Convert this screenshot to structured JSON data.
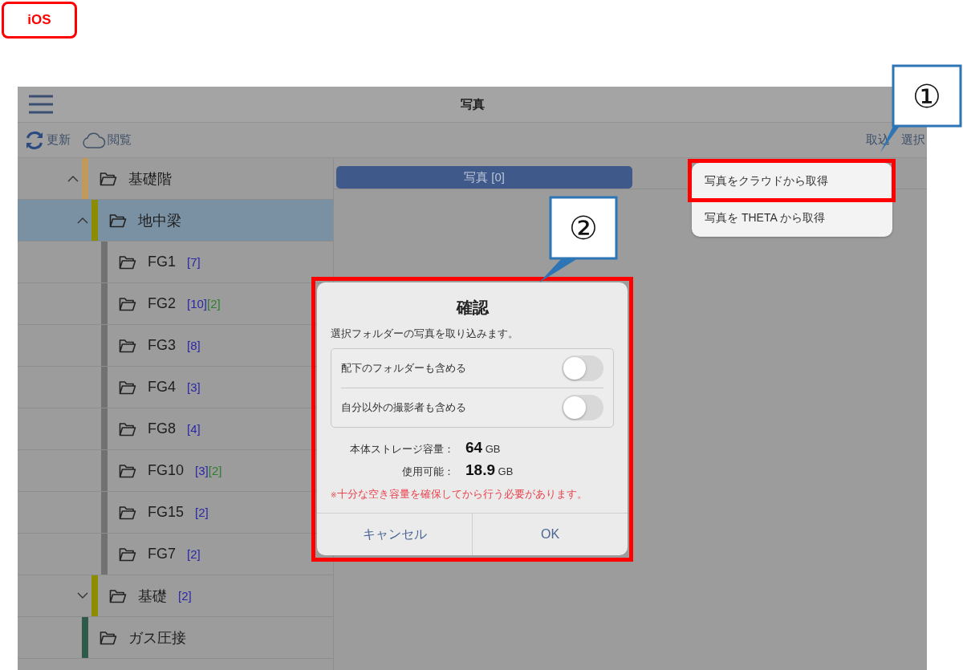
{
  "platform_badge": "iOS",
  "header": {
    "title": "写真"
  },
  "toolbar": {
    "left": [
      {
        "label": "更新",
        "kind": "refresh"
      },
      {
        "label": "閲覧",
        "kind": "cloud"
      }
    ],
    "right": [
      {
        "label": "取込"
      },
      {
        "label": "選択"
      }
    ]
  },
  "tree": [
    {
      "label": "基礎階",
      "color": "#c09a5b",
      "expanded": true,
      "selected": false,
      "children": [
        {
          "label": "地中梁",
          "color": "#8c8c00",
          "expanded": true,
          "selected": true,
          "children": [
            {
              "label": "FG1",
              "color": "#727272",
              "selected": false,
              "counts": [
                {
                  "text": "[7]",
                  "kind": "photos"
                }
              ]
            },
            {
              "label": "FG2",
              "color": "#727272",
              "selected": false,
              "counts": [
                {
                  "text": "[10]",
                  "kind": "photos"
                },
                {
                  "text": "[2]",
                  "kind": "other"
                }
              ]
            },
            {
              "label": "FG3",
              "color": "#727272",
              "selected": false,
              "counts": [
                {
                  "text": "[8]",
                  "kind": "photos"
                }
              ]
            },
            {
              "label": "FG4",
              "color": "#727272",
              "selected": false,
              "counts": [
                {
                  "text": "[3]",
                  "kind": "photos"
                }
              ]
            },
            {
              "label": "FG8",
              "color": "#727272",
              "selected": false,
              "counts": [
                {
                  "text": "[4]",
                  "kind": "photos"
                }
              ]
            },
            {
              "label": "FG10",
              "color": "#727272",
              "selected": false,
              "counts": [
                {
                  "text": "[3]",
                  "kind": "photos"
                },
                {
                  "text": "[2]",
                  "kind": "other"
                }
              ]
            },
            {
              "label": "FG15",
              "color": "#727272",
              "selected": false,
              "counts": [
                {
                  "text": "[2]",
                  "kind": "photos"
                }
              ]
            },
            {
              "label": "FG7",
              "color": "#727272",
              "selected": false,
              "counts": [
                {
                  "text": "[2]",
                  "kind": "photos"
                }
              ]
            }
          ]
        },
        {
          "label": "基礎",
          "color": "#8c8c00",
          "expanded": false,
          "selected": false,
          "counts": [
            {
              "text": "[2]",
              "kind": "photos"
            }
          ]
        }
      ]
    },
    {
      "label": "ガス圧接",
      "color": "#2f5a4a",
      "selected": false
    }
  ],
  "photo_tab": {
    "label": "写真 [0]"
  },
  "import_menu": {
    "items": [
      "写真をクラウドから取得",
      "写真を THETA から取得"
    ]
  },
  "dialog": {
    "title": "確認",
    "message": "選択フォルダーの写真を取り込みます。",
    "toggles": [
      {
        "label": "配下のフォルダーも含める",
        "on": false
      },
      {
        "label": "自分以外の撮影者も含める",
        "on": false
      }
    ],
    "storage": [
      {
        "label": "本体ストレージ容量：",
        "value": "64",
        "unit": "GB"
      },
      {
        "label": "使用可能：",
        "value": "18.9",
        "unit": "GB"
      }
    ],
    "warning_mark": "※",
    "warning": "十分な空き容量を確保してから行う必要があります。",
    "buttons": [
      "キャンセル",
      "OK"
    ]
  },
  "callouts": [
    {
      "label": "①"
    },
    {
      "label": "②"
    }
  ]
}
